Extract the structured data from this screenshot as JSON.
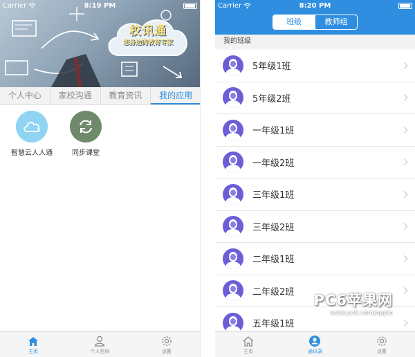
{
  "left_screen": {
    "status": {
      "carrier": "Carrier",
      "time": "8:19 PM"
    },
    "banner": {
      "title": "校讯通",
      "slogan": "您身边的教育专家"
    },
    "tabs": [
      {
        "label": "个人中心",
        "active": false
      },
      {
        "label": "家校沟通",
        "active": false
      },
      {
        "label": "教育资讯",
        "active": false
      },
      {
        "label": "我的应用",
        "active": true
      }
    ],
    "apps": [
      {
        "label": "智慧云人人通",
        "icon": "cloud-icon",
        "color": "#8fd4f2"
      },
      {
        "label": "同步课堂",
        "icon": "sync-arrows-icon",
        "color": "#6f8a6a"
      }
    ],
    "tabbar": [
      {
        "label": "主页",
        "icon": "home-icon",
        "active": true
      },
      {
        "label": "个人空间",
        "icon": "person-icon",
        "active": false
      },
      {
        "label": "设置",
        "icon": "gear-icon",
        "active": false
      }
    ]
  },
  "right_screen": {
    "status": {
      "carrier": "Carrier",
      "time": "8:20 PM"
    },
    "segments": [
      {
        "label": "班级",
        "active": true
      },
      {
        "label": "教师组",
        "active": false
      }
    ],
    "section_title": "我的班级",
    "classes": [
      "5年级1班",
      "5年级2班",
      "一年级1班",
      "一年级2班",
      "三年级1班",
      "三年级2班",
      "二年级1班",
      "二年级2班",
      "五年级1班"
    ],
    "tabbar": [
      {
        "label": "主页",
        "icon": "home-icon",
        "active": false
      },
      {
        "label": "通讯录",
        "icon": "contacts-icon",
        "active": true
      },
      {
        "label": "设置",
        "icon": "gear-icon",
        "active": false
      }
    ]
  },
  "watermark": {
    "brand": "PC6苹果网",
    "url": "www.pc6.com/apple"
  },
  "colors": {
    "accent": "#2f8ee0",
    "avatar": "#6a5fd6"
  }
}
